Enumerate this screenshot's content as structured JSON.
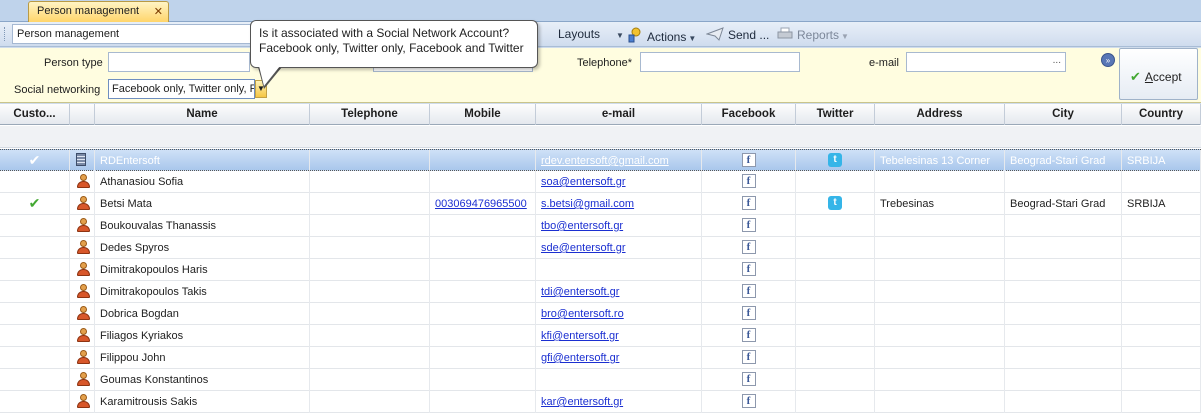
{
  "tab": {
    "title": "Person management",
    "close": "✕"
  },
  "toolbar": {
    "combo_value": "Person management",
    "layouts": "Layouts",
    "actions": "Actions",
    "send": "Send ...",
    "reports": "Reports"
  },
  "criteria": {
    "person_type_label": "Person type",
    "person_type_value": "",
    "social_label": "Social networking",
    "social_value": "Facebook only, Twitter only, F",
    "telephone_label": "Telephone*",
    "telephone_value": "",
    "email_label": "e-mail",
    "email_value": "",
    "email_ellipsis": "...",
    "accept_rest": "ccept",
    "accept_mnemonic": "A"
  },
  "tooltip": {
    "line1": "Is it associated with a Social Network Account?",
    "line2": "Facebook only, Twitter only, Facebook and Twitter"
  },
  "grid": {
    "columns": [
      "Custo...",
      "",
      "Name",
      "Telephone",
      "Mobile",
      "e-mail",
      "Facebook",
      "Twitter",
      "Address",
      "City",
      "Country"
    ],
    "rows": [
      {
        "customer": true,
        "type": "org",
        "name": "RDEntersoft",
        "telephone": "",
        "mobile": "",
        "email": "rdev.entersoft@gmail.com",
        "facebook": true,
        "twitter": true,
        "address": "Tebelesinas 13 Corner",
        "city": "Beograd-Stari Grad",
        "country": "SRBIJA",
        "selected": true
      },
      {
        "customer": false,
        "type": "person",
        "name": "Athanasiou Sofia",
        "telephone": "",
        "mobile": "",
        "email": "soa@entersoft.gr",
        "facebook": true,
        "twitter": false,
        "address": "",
        "city": "",
        "country": ""
      },
      {
        "customer": true,
        "type": "person",
        "name": "Betsi Mata",
        "telephone": "",
        "mobile": "003069476965500",
        "email": "s.betsi@gmail.com",
        "facebook": true,
        "twitter": true,
        "address": "Trebesinas",
        "city": "Beograd-Stari Grad",
        "country": "SRBIJA"
      },
      {
        "customer": false,
        "type": "person",
        "name": "Boukouvalas Thanassis",
        "telephone": "",
        "mobile": "",
        "email": "tbo@entersoft.gr",
        "facebook": true,
        "twitter": false,
        "address": "",
        "city": "",
        "country": ""
      },
      {
        "customer": false,
        "type": "person",
        "name": "Dedes Spyros",
        "telephone": "",
        "mobile": "",
        "email": "sde@entersoft.gr",
        "facebook": true,
        "twitter": false,
        "address": "",
        "city": "",
        "country": ""
      },
      {
        "customer": false,
        "type": "person",
        "name": "Dimitrakopoulos Haris",
        "telephone": "",
        "mobile": "",
        "email": "",
        "facebook": true,
        "twitter": false,
        "address": "",
        "city": "",
        "country": ""
      },
      {
        "customer": false,
        "type": "person",
        "name": "Dimitrakopoulos Takis",
        "telephone": "",
        "mobile": "",
        "email": "tdi@entersoft.gr",
        "facebook": true,
        "twitter": false,
        "address": "",
        "city": "",
        "country": ""
      },
      {
        "customer": false,
        "type": "person",
        "name": "Dobrica Bogdan",
        "telephone": "",
        "mobile": "",
        "email": "bro@entersoft.ro",
        "facebook": true,
        "twitter": false,
        "address": "",
        "city": "",
        "country": ""
      },
      {
        "customer": false,
        "type": "person",
        "name": "Filiagos Kyriakos",
        "telephone": "",
        "mobile": "",
        "email": "kfi@entersoft.gr",
        "facebook": true,
        "twitter": false,
        "address": "",
        "city": "",
        "country": ""
      },
      {
        "customer": false,
        "type": "person",
        "name": "Filippou John",
        "telephone": "",
        "mobile": "",
        "email": "gfi@entersoft.gr",
        "facebook": true,
        "twitter": false,
        "address": "",
        "city": "",
        "country": ""
      },
      {
        "customer": false,
        "type": "person",
        "name": "Goumas Konstantinos",
        "telephone": "",
        "mobile": "",
        "email": "",
        "facebook": true,
        "twitter": false,
        "address": "",
        "city": "",
        "country": ""
      },
      {
        "customer": false,
        "type": "person",
        "name": "Karamitrousis Sakis",
        "telephone": "",
        "mobile": "",
        "email": "kar@entersoft.gr",
        "facebook": true,
        "twitter": false,
        "address": "",
        "city": "",
        "country": ""
      }
    ]
  },
  "icons": {
    "check": "✔",
    "facebook": "f",
    "twitter": "t"
  },
  "colors": {
    "tab_active": "#ffd56b",
    "criteria_bg": "#fffde0",
    "link": "#1b2fd1",
    "selected_row": "#a9c7ec"
  }
}
